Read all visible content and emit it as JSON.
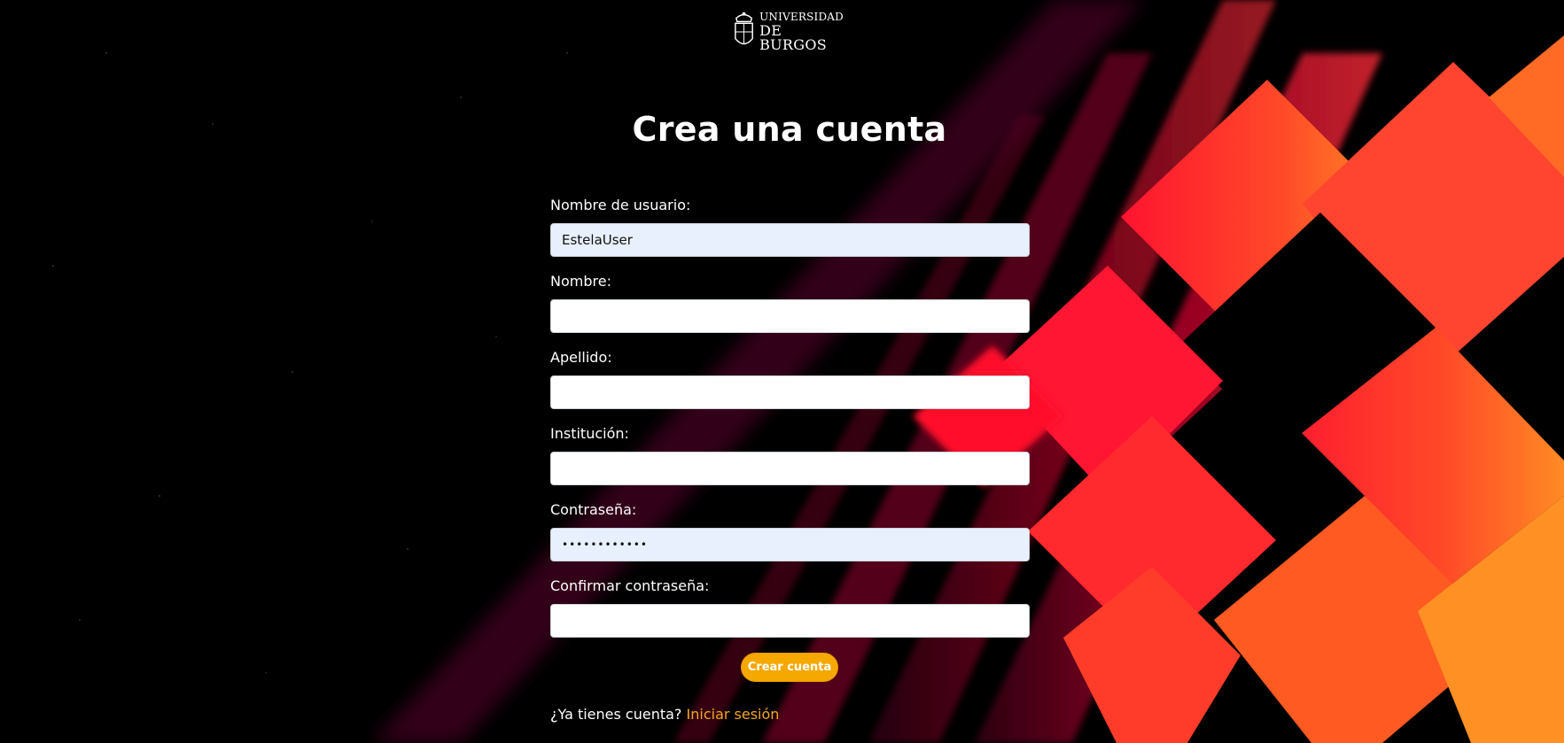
{
  "header": {
    "logo_line1": "UNIVERSIDAD",
    "logo_line2": "DE BURGOS",
    "title": "Crea una cuenta"
  },
  "form": {
    "username": {
      "label": "Nombre de usuario:",
      "value": "EstelaUser"
    },
    "first_name": {
      "label": "Nombre:",
      "value": ""
    },
    "last_name": {
      "label": "Apellido:",
      "value": ""
    },
    "institution": {
      "label": "Institución:",
      "value": ""
    },
    "password": {
      "label": "Contraseña:",
      "value": "••••••••••••"
    },
    "confirm_password": {
      "label": "Confirmar contraseña:",
      "value": ""
    },
    "submit_label": "Crear cuenta"
  },
  "footer": {
    "question": "¿Ya tienes cuenta?",
    "login_link": "Iniciar sesión"
  },
  "colors": {
    "accent": "#f5a800",
    "link": "#f5a623",
    "autofill": "#e8f0fe"
  },
  "icons": [
    "university-crest-icon"
  ]
}
